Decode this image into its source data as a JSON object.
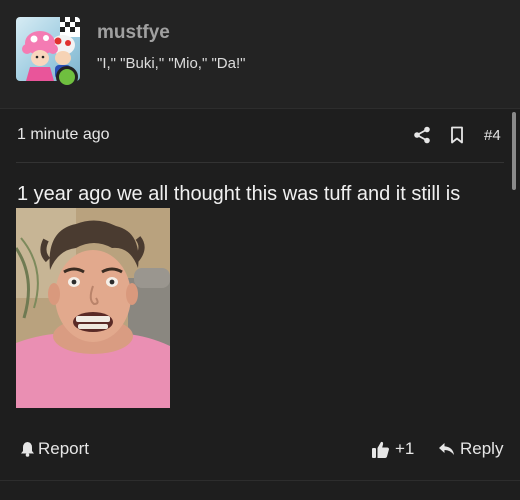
{
  "user": {
    "username": "mustfye",
    "title": "\"I,\" \"Buki,\" \"Mio,\" \"Da!\"",
    "online_color": "#6fbf3f",
    "avatar_icon": "toad-characters-avatar"
  },
  "meta": {
    "timestamp": "1 minute ago",
    "post_number": "#4"
  },
  "post": {
    "text": "1 year ago we all thought this was tuff and it still is",
    "image_icon": "meme-photo"
  },
  "actions": {
    "report_label": "Report",
    "like_label": "+1",
    "reply_label": "Reply"
  }
}
